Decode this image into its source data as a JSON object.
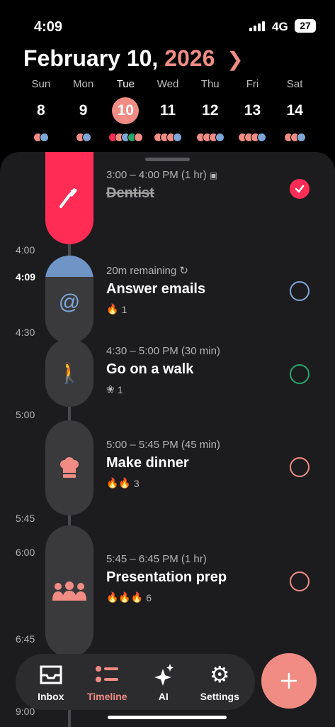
{
  "status": {
    "time": "4:09",
    "network": "4G",
    "battery": "27"
  },
  "header": {
    "month_day": "February 10,",
    "year": "2026",
    "next_icon": "chevron-right-icon"
  },
  "week": [
    {
      "name": "Sun",
      "num": "8",
      "dots": [
        "#F08C84",
        "#7EA7D8"
      ]
    },
    {
      "name": "Mon",
      "num": "9",
      "dots": [
        "#F08C84",
        "#7EA7D8"
      ]
    },
    {
      "name": "Tue",
      "num": "10",
      "selected": true,
      "dots": [
        "#FF2D55",
        "#F08C84",
        "#7EA7D8",
        "#27A56B",
        "#F08C84"
      ]
    },
    {
      "name": "Wed",
      "num": "11",
      "dots": [
        "#F08C84",
        "#F08C84",
        "#F08C84",
        "#7EA7D8"
      ]
    },
    {
      "name": "Thu",
      "num": "12",
      "dots": [
        "#F08C84",
        "#F08C84",
        "#F08C84",
        "#7EA7D8"
      ]
    },
    {
      "name": "Fri",
      "num": "13",
      "dots": [
        "#F08C84",
        "#F08C84",
        "#F08C84",
        "#7EA7D8"
      ]
    },
    {
      "name": "Sat",
      "num": "14",
      "dots": [
        "#F08C84",
        "#F08C84",
        "#7EA7D8"
      ]
    }
  ],
  "time_labels": [
    "4:00",
    "4:09",
    "4:30",
    "5:00",
    "5:45",
    "6:00",
    "6:45",
    "9:00"
  ],
  "events": [
    {
      "meta": "3:00 – 4:00 PM (1 hr)",
      "title": "Dentist",
      "icon": "toothbrush-icon",
      "done": true,
      "color": "#FF2D55"
    },
    {
      "meta": "20m remaining",
      "title": "Answer emails",
      "icon": "at-sign-icon",
      "energy": "1",
      "done": false,
      "color": "#7EA7D8"
    },
    {
      "meta": "4:30 – 5:00 PM (30 min)",
      "title": "Go on a walk",
      "icon": "walking-icon",
      "energy": "1",
      "done": false,
      "color": "#27A56B"
    },
    {
      "meta": "5:00 – 5:45 PM (45 min)",
      "title": "Make dinner",
      "icon": "chef-hat-icon",
      "energy": "3",
      "done": false,
      "color": "#F08C84"
    },
    {
      "meta": "5:45 – 6:45 PM (1 hr)",
      "title": "Presentation prep",
      "icon": "group-icon",
      "energy": "6",
      "done": false,
      "color": "#F08C84"
    }
  ],
  "tabs": [
    {
      "label": "Inbox",
      "icon": "inbox-icon"
    },
    {
      "label": "Timeline",
      "icon": "timeline-icon",
      "active": true
    },
    {
      "label": "AI",
      "icon": "sparkle-icon"
    },
    {
      "label": "Settings",
      "icon": "gear-icon"
    }
  ],
  "colors": {
    "accent": "#F08C84",
    "red": "#FF2D55",
    "blue": "#7EA7D8",
    "green": "#27A56B"
  }
}
